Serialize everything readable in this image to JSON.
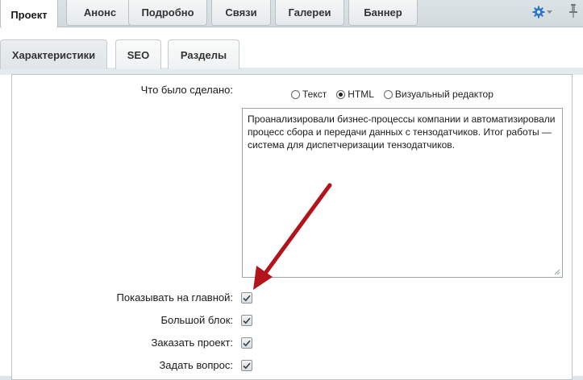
{
  "top_tabs": [
    {
      "label": "Проект",
      "active": true
    },
    {
      "label": "Анонс",
      "active": false
    },
    {
      "label": "Подробно",
      "active": false
    },
    {
      "label": "Связи",
      "active": false
    },
    {
      "label": "Галереи",
      "active": false
    },
    {
      "label": "Баннер",
      "active": false
    }
  ],
  "sub_tabs": [
    {
      "label": "Характеристики"
    },
    {
      "label": "SEO"
    },
    {
      "label": "Разделы"
    }
  ],
  "done_field": {
    "label": "Что было сделано:",
    "modes": [
      {
        "label": "Текст",
        "checked": false
      },
      {
        "label": "HTML",
        "checked": true
      },
      {
        "label": "Визуальный редактор",
        "checked": false
      }
    ],
    "value": "Проанализировали бизнес-процессы компании и автоматизировали процесс сбора и передачи данных с тензодатчиков. Итог работы — система для диспетчеризации тензодатчиков."
  },
  "checkboxes": [
    {
      "label": "Показывать на главной:",
      "checked": true
    },
    {
      "label": "Большой блок:",
      "checked": true
    },
    {
      "label": "Заказать проект:",
      "checked": true
    },
    {
      "label": "Задать вопрос:",
      "checked": true
    }
  ],
  "colors": {
    "accent_gear": "#2b74c7",
    "arrow": "#b3141c"
  },
  "icons": {
    "settings": "gear-icon",
    "pin": "pin-icon",
    "annotation": "arrow-icon"
  }
}
